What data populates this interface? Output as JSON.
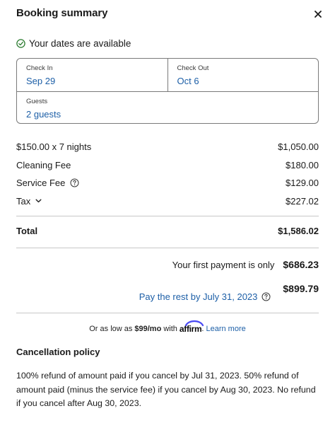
{
  "header": {
    "title": "Booking summary",
    "close_icon": "close-icon"
  },
  "availability": {
    "text": "Your dates are available",
    "icon": "check-circle-icon",
    "color": "#2e7d32"
  },
  "dates": {
    "check_in_label": "Check In",
    "check_in_value": "Sep 29",
    "check_out_label": "Check Out",
    "check_out_value": "Oct 6",
    "guests_label": "Guests",
    "guests_value": "2 guests"
  },
  "line_items": [
    {
      "label": "$150.00 x 7 nights",
      "amount": "$1,050.00"
    },
    {
      "label": "Cleaning Fee",
      "amount": "$180.00"
    },
    {
      "label": "Service Fee",
      "amount": "$129.00",
      "icon": "help-icon"
    },
    {
      "label": "Tax",
      "amount": "$227.02",
      "icon": "chevron-down-icon"
    }
  ],
  "total": {
    "label": "Total",
    "amount": "$1,586.02"
  },
  "first_payment": {
    "label": "Your first payment is only",
    "amount": "$686.23"
  },
  "rest_payment": {
    "link": "Pay the rest by July 31, 2023",
    "amount": "$899.79",
    "icon": "help-icon"
  },
  "affirm": {
    "prefix": "Or as low as",
    "price": "$99/mo",
    "with": "with",
    "brand": "affirm",
    "suffix": ".",
    "learn_more": "Learn more"
  },
  "cancellation": {
    "title": "Cancellation policy",
    "text": "100% refund of amount paid if you cancel by Jul 31, 2023. 50% refund of amount paid (minus the service fee) if you cancel by Aug 30, 2023. No refund if you cancel after Aug 30, 2023."
  },
  "colors": {
    "link": "#1d5fa7",
    "border": "#7a7a7a",
    "divider": "#c8c8c8",
    "affirm_arc": "#4a4af4"
  }
}
